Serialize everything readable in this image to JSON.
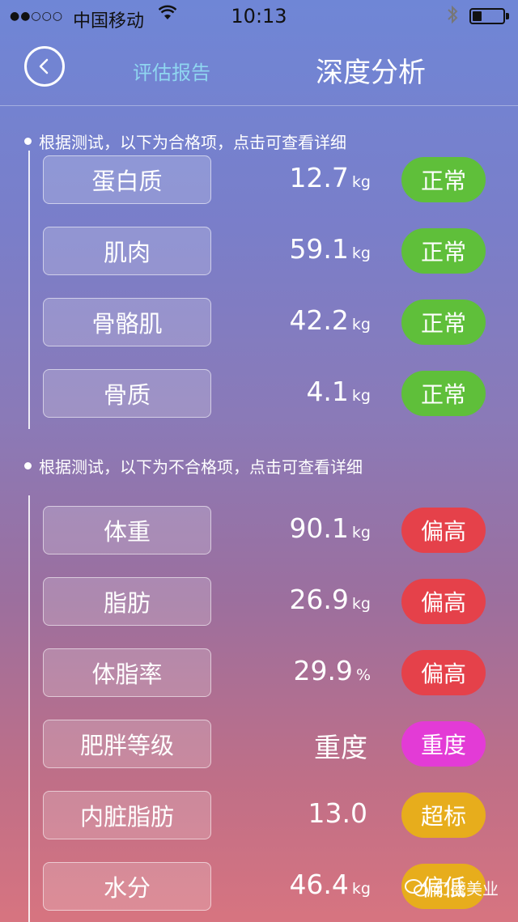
{
  "status_bar": {
    "signal": "●●○○○",
    "carrier": "中国移动",
    "time": "10:13",
    "battery_level": 0.3
  },
  "nav": {
    "tab_report": "评估报告",
    "title": "深度分析"
  },
  "qualified": {
    "title": "根据测试，以下为合格项，点击可查看详细",
    "items": [
      {
        "name": "蛋白质",
        "value": "12.7",
        "unit": "kg",
        "status": "正常",
        "color": "#5fbf3a"
      },
      {
        "name": "肌肉",
        "value": "59.1",
        "unit": "kg",
        "status": "正常",
        "color": "#5fbf3a"
      },
      {
        "name": "骨骼肌",
        "value": "42.2",
        "unit": "kg",
        "status": "正常",
        "color": "#5fbf3a"
      },
      {
        "name": "骨质",
        "value": "4.1",
        "unit": "kg",
        "status": "正常",
        "color": "#5fbf3a"
      }
    ]
  },
  "unqualified": {
    "title": "根据测试，以下为不合格项，点击可查看详细",
    "items": [
      {
        "name": "体重",
        "value": "90.1",
        "unit": "kg",
        "status": "偏高",
        "color": "#e5414a"
      },
      {
        "name": "脂肪",
        "value": "26.9",
        "unit": "kg",
        "status": "偏高",
        "color": "#e5414a"
      },
      {
        "name": "体脂率",
        "value": "29.9",
        "unit": "%",
        "status": "偏高",
        "color": "#e5414a"
      },
      {
        "name": "肥胖等级",
        "value": "重度",
        "unit": "",
        "status": "重度",
        "color": "#e33bd6"
      },
      {
        "name": "内脏脂肪",
        "value": "13.0",
        "unit": "",
        "status": "超标",
        "color": "#e7ad1c"
      },
      {
        "name": "水分",
        "value": "46.4",
        "unit": "kg",
        "status": "偏低",
        "color": "#e7ad1c"
      }
    ]
  },
  "watermark": "幻盛美业"
}
